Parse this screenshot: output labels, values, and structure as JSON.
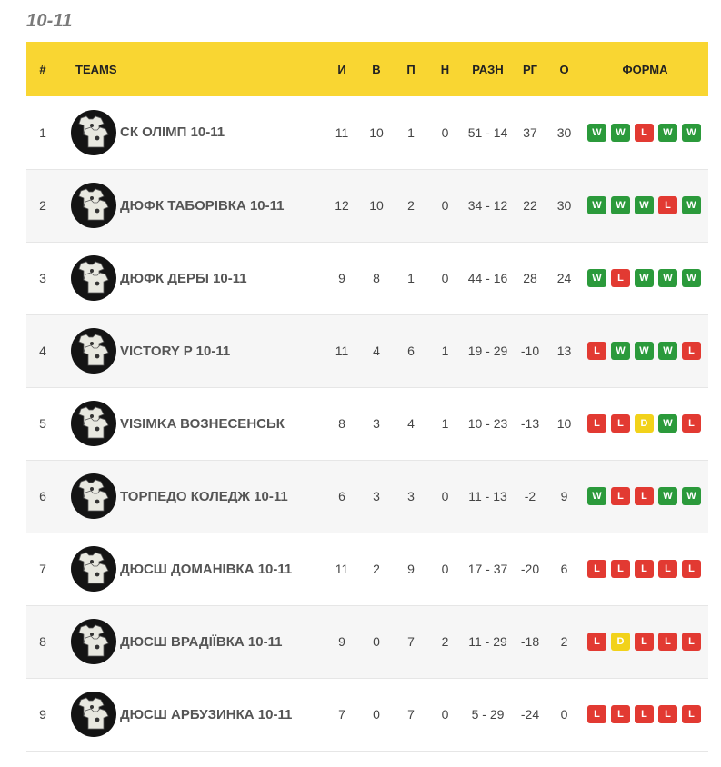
{
  "title": "10-11",
  "headers": {
    "pos": "#",
    "teams": "TEAMS",
    "played": "И",
    "won": "В",
    "lost": "П",
    "drawn": "Н",
    "diff": "РАЗН",
    "gd": "РГ",
    "points": "О",
    "form": "ФОРМА"
  },
  "icons": {
    "team_logo": "jersey-icon"
  },
  "colors": {
    "header": "#f9d632",
    "win": "#2b9a3b",
    "loss": "#e23a32",
    "draw": "#f2d21a"
  },
  "rows": [
    {
      "pos": "1",
      "team": "СК ОЛІМП 10-11",
      "played": "11",
      "won": "10",
      "lost": "1",
      "drawn": "0",
      "diff": "51 - 14",
      "gd": "37",
      "points": "30",
      "form": [
        "W",
        "W",
        "L",
        "W",
        "W"
      ]
    },
    {
      "pos": "2",
      "team": "ДЮФК ТАБОРІВКА 10-11",
      "played": "12",
      "won": "10",
      "lost": "2",
      "drawn": "0",
      "diff": "34 - 12",
      "gd": "22",
      "points": "30",
      "form": [
        "W",
        "W",
        "W",
        "L",
        "W"
      ]
    },
    {
      "pos": "3",
      "team": "ДЮФК ДЕРБІ 10-11",
      "played": "9",
      "won": "8",
      "lost": "1",
      "drawn": "0",
      "diff": "44 - 16",
      "gd": "28",
      "points": "24",
      "form": [
        "W",
        "L",
        "W",
        "W",
        "W"
      ]
    },
    {
      "pos": "4",
      "team": "VICTORY P 10-11",
      "played": "11",
      "won": "4",
      "lost": "6",
      "drawn": "1",
      "diff": "19 - 29",
      "gd": "-10",
      "points": "13",
      "form": [
        "L",
        "W",
        "W",
        "W",
        "L"
      ]
    },
    {
      "pos": "5",
      "team": "VISIMKA ВОЗНЕСЕНСЬК",
      "played": "8",
      "won": "3",
      "lost": "4",
      "drawn": "1",
      "diff": "10 - 23",
      "gd": "-13",
      "points": "10",
      "form": [
        "L",
        "L",
        "D",
        "W",
        "L"
      ]
    },
    {
      "pos": "6",
      "team": "ТОРПЕДО КОЛЕДЖ 10-11",
      "played": "6",
      "won": "3",
      "lost": "3",
      "drawn": "0",
      "diff": "11 - 13",
      "gd": "-2",
      "points": "9",
      "form": [
        "W",
        "L",
        "L",
        "W",
        "W"
      ]
    },
    {
      "pos": "7",
      "team": "ДЮСШ ДОМАНІВКА 10-11",
      "played": "11",
      "won": "2",
      "lost": "9",
      "drawn": "0",
      "diff": "17 - 37",
      "gd": "-20",
      "points": "6",
      "form": [
        "L",
        "L",
        "L",
        "L",
        "L"
      ]
    },
    {
      "pos": "8",
      "team": "ДЮСШ ВРАДІЇВКА 10-11",
      "played": "9",
      "won": "0",
      "lost": "7",
      "drawn": "2",
      "diff": "11 - 29",
      "gd": "-18",
      "points": "2",
      "form": [
        "L",
        "D",
        "L",
        "L",
        "L"
      ]
    },
    {
      "pos": "9",
      "team": "ДЮСШ АРБУЗИНКА 10-11",
      "played": "7",
      "won": "0",
      "lost": "7",
      "drawn": "0",
      "diff": "5 - 29",
      "gd": "-24",
      "points": "0",
      "form": [
        "L",
        "L",
        "L",
        "L",
        "L"
      ]
    }
  ]
}
